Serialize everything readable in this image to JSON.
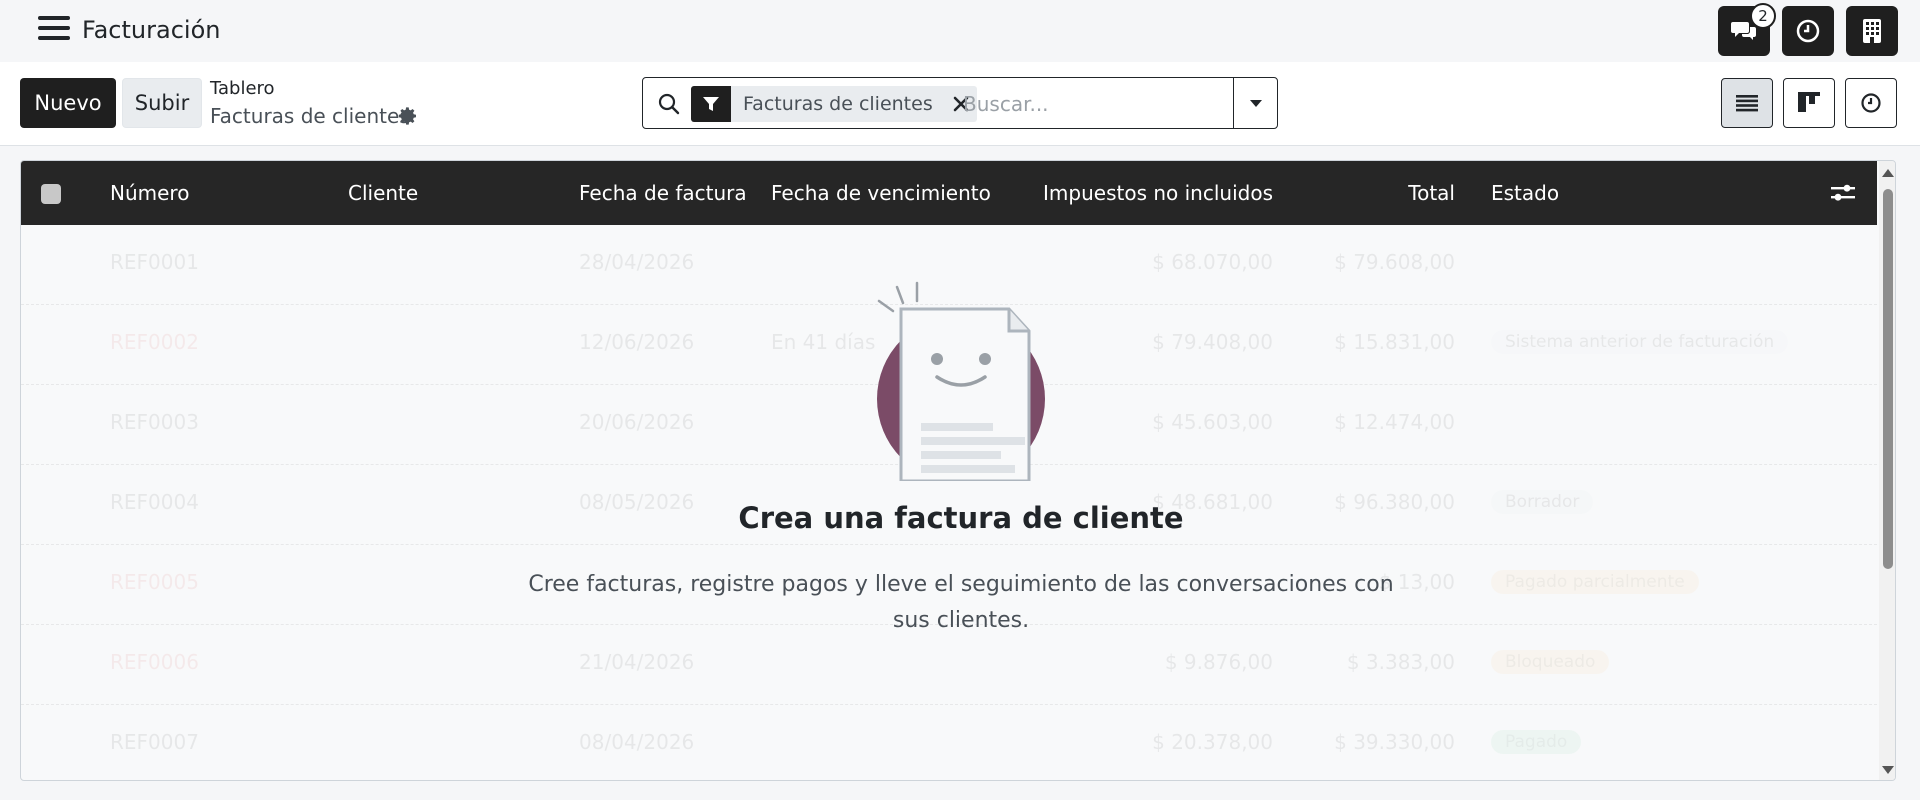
{
  "navbar": {
    "app_title": "Facturación",
    "messages_badge": "2"
  },
  "control_panel": {
    "new_label": "Nuevo",
    "upload_label": "Subir",
    "breadcrumb_parent": "Tablero",
    "breadcrumb_current": "Facturas de clientes",
    "search": {
      "facet_label": "Facturas de clientes",
      "placeholder": "Buscar..."
    }
  },
  "list": {
    "columns": [
      "Número",
      "Cliente",
      "Fecha de factura",
      "Fecha de vencimiento",
      "Impuestos no incluidos",
      "Total",
      "Estado"
    ],
    "rows": [
      {
        "number": "REF0001",
        "invoice_date": "28/04/2026",
        "due": "",
        "untaxed": "$ 68.070,00",
        "total": "$ 79.608,00",
        "status": ""
      },
      {
        "number": "REF0002",
        "invoice_date": "12/06/2026",
        "due": "En 41 días",
        "untaxed": "$ 79.408,00",
        "total": "$ 15.831,00",
        "status": "Sistema anterior de facturación"
      },
      {
        "number": "REF0003",
        "invoice_date": "20/06/2026",
        "due": "",
        "untaxed": "$ 45.603,00",
        "total": "$ 12.474,00",
        "status": ""
      },
      {
        "number": "REF0004",
        "invoice_date": "08/05/2026",
        "due": "",
        "untaxed": "$ 48.681,00",
        "total": "$ 96.380,00",
        "status": "Borrador"
      },
      {
        "number": "REF0005",
        "invoice_date": "",
        "due": "",
        "untaxed": "",
        "total": "$ 13,00",
        "status": "Pagado parcialmente"
      },
      {
        "number": "REF0006",
        "invoice_date": "21/04/2026",
        "due": "",
        "untaxed": "$ 9.876,00",
        "total": "$ 3.383,00",
        "status": "Bloqueado"
      },
      {
        "number": "REF0007",
        "invoice_date": "08/04/2026",
        "due": "",
        "untaxed": "$ 20.378,00",
        "total": "$ 39.330,00",
        "status": "Pagado"
      }
    ]
  },
  "helper": {
    "title": "Crea una factura de cliente",
    "text": "Cree facturas, registre pagos y lleve el seguimiento de las conversaciones con sus clientes."
  },
  "colors": {
    "dark": "#1f1f1f",
    "accent_plum": "#7b4b67"
  }
}
